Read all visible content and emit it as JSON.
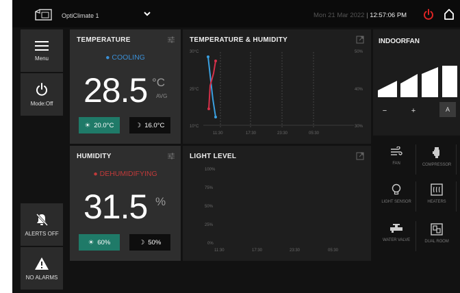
{
  "header": {
    "device_name": "OptiClimate 1",
    "date": "Mon 21 Mar 2022",
    "separator": "|",
    "time": "12:57:06 PM"
  },
  "sidebar": {
    "menu_label": "Menu",
    "mode_label": "Mode:Off",
    "alerts_label": "ALERTS OFF",
    "alarms_label": "NO ALARMS"
  },
  "temperature": {
    "title": "TEMPERATURE",
    "status": "COOLING",
    "value": "28.5",
    "unit": "°C",
    "unit_sub": "AVG",
    "day_setpoint": "20.0°C",
    "night_setpoint": "16.0°C"
  },
  "humidity": {
    "title": "HUMIDITY",
    "status": "DEHUMIDIFYING",
    "value": "31.5",
    "unit": "%",
    "day_setpoint": "60%",
    "night_setpoint": "50%"
  },
  "temp_humidity_chart": {
    "title": "TEMPERATURE & HUMIDITY",
    "left_ticks": [
      "30°C",
      "25°C",
      "10°C"
    ],
    "right_ticks": [
      "50%",
      "40%",
      "30%"
    ],
    "x_ticks": [
      "11:30",
      "17:30",
      "23:30",
      "05:30"
    ]
  },
  "light_chart": {
    "title": "LIGHT LEVEL",
    "y_ticks": [
      "100%",
      "75%",
      "50%",
      "25%",
      "0%"
    ],
    "x_ticks": [
      "11:30",
      "17:30",
      "23:30",
      "05:30"
    ]
  },
  "indoorfan": {
    "title": "INDOORFAN",
    "minus": "−",
    "plus": "+",
    "auto": "A",
    "level_bars": 4
  },
  "tiles": {
    "fan": "FAN",
    "compressor": "COMPRESSOR",
    "light_sensor": "LIGHT SENSOR",
    "heaters": "HEATERS",
    "water_valve": "WATER VALVE",
    "dual_room": "DUAL ROOM"
  },
  "colors": {
    "cooling": "#3a8fd6",
    "dehumidifying": "#c23a3a",
    "power": "#e02424",
    "day_pill": "#1f7a68",
    "temp_line": "#d6304a",
    "humidity_line": "#3aa0e0"
  },
  "chart_data": [
    {
      "type": "line",
      "title": "TEMPERATURE & HUMIDITY",
      "x": [
        "11:30",
        "17:30",
        "23:30",
        "05:30"
      ],
      "y_left_ticks": [
        "30°C",
        "25°C",
        "10°C"
      ],
      "y_right_ticks": [
        "50%",
        "40%",
        "30%"
      ],
      "series": []
    },
    {
      "type": "line",
      "title": "LIGHT LEVEL",
      "x": [
        "11:30",
        "17:30",
        "23:30",
        "05:30"
      ],
      "y_ticks": [
        "100%",
        "75%",
        "50%",
        "25%",
        "0%"
      ],
      "ylim": [
        0,
        100
      ],
      "series": []
    }
  ]
}
